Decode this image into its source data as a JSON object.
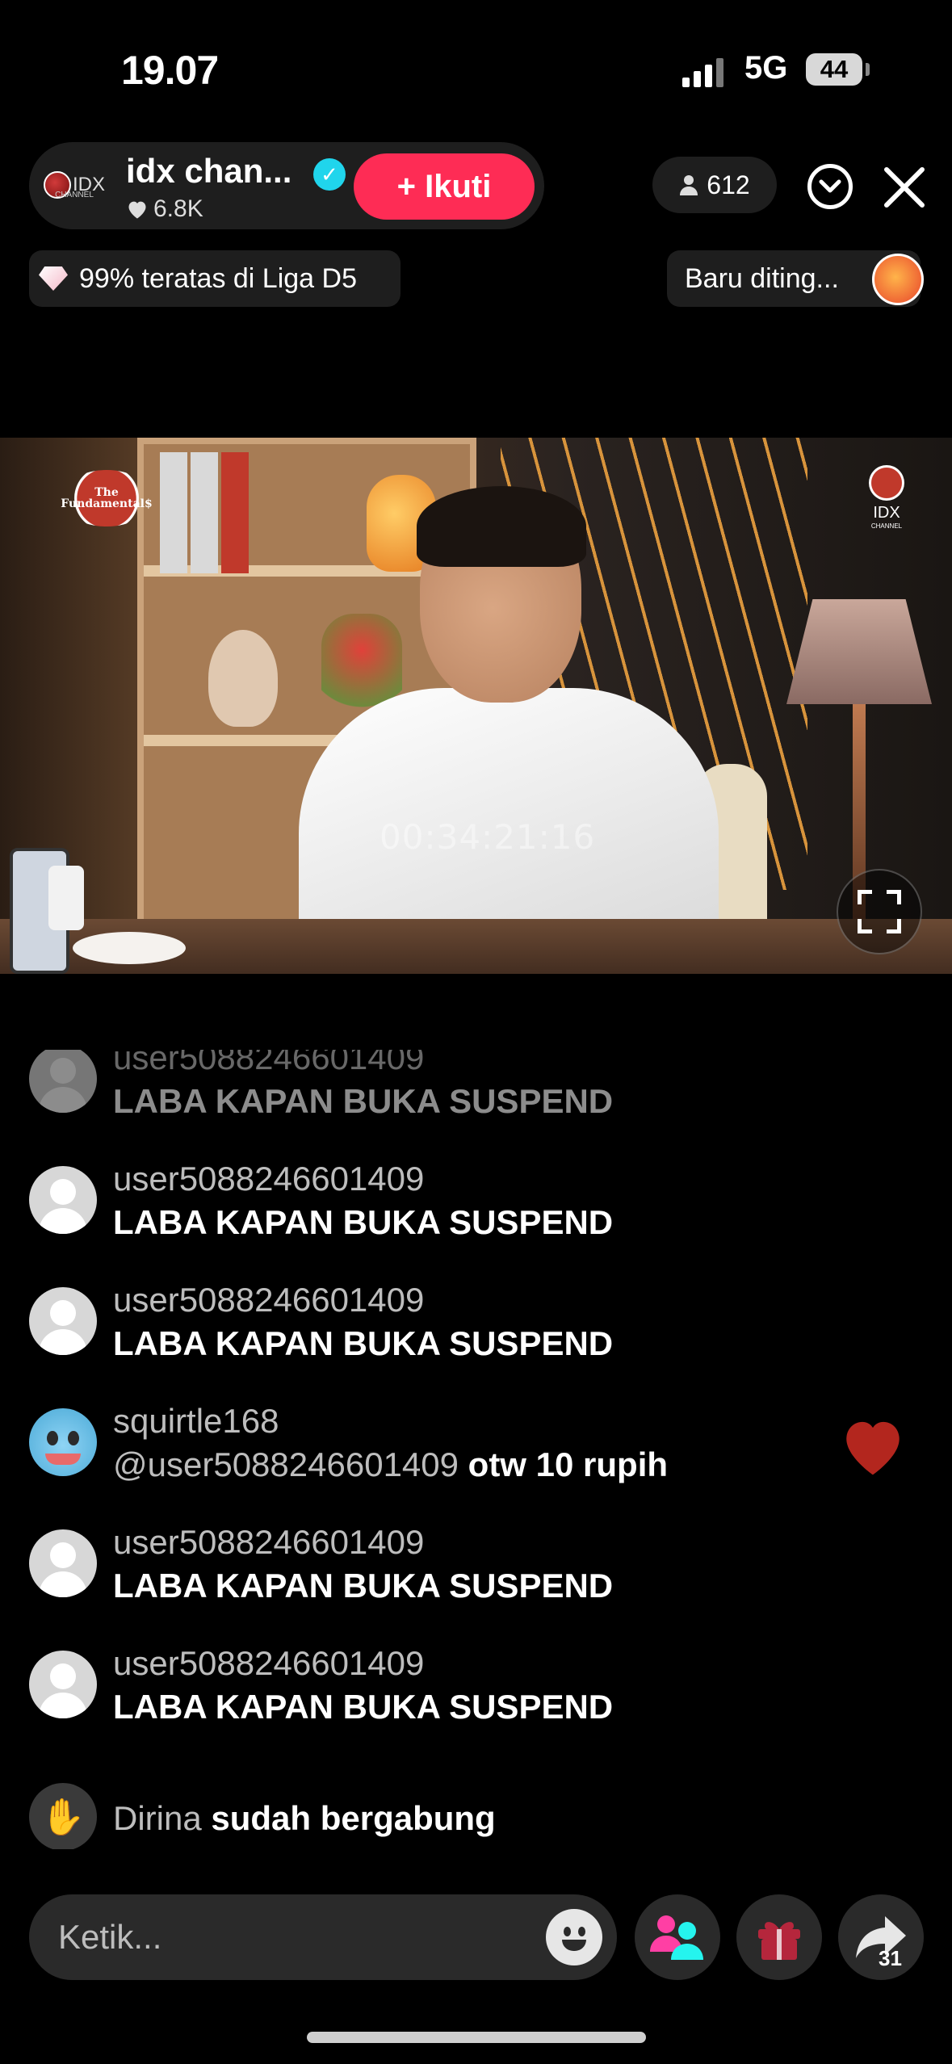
{
  "status_bar": {
    "time": "19.07",
    "network": "5G",
    "battery": "44"
  },
  "host": {
    "logo_text": "IDX",
    "logo_sub": "CHANNEL",
    "name": "idx chan...",
    "likes": "6.8K",
    "follow_label": "+ Ikuti"
  },
  "top_right": {
    "viewers": "612"
  },
  "badges": {
    "league": "99% teratas di Liga D5",
    "recent": "Baru diting..."
  },
  "video": {
    "show_logo": "The Fundamental$",
    "watermark": "IDX",
    "watermark_sub": "CHANNEL",
    "timecode": "00:34:21:16"
  },
  "comments": [
    {
      "user": "user5088246601409",
      "message": "LABA KAPAN BUKA SUSPEND",
      "avatar": "default"
    },
    {
      "user": "user5088246601409",
      "message": "LABA KAPAN BUKA SUSPEND",
      "avatar": "default"
    },
    {
      "user": "user5088246601409",
      "message": "LABA KAPAN BUKA SUSPEND",
      "avatar": "default"
    },
    {
      "user": "squirtle168",
      "mention": "@user5088246601409",
      "message": " otw 10 rupih",
      "avatar": "squirtle"
    },
    {
      "user": "user5088246601409",
      "message": "LABA KAPAN BUKA SUSPEND",
      "avatar": "default"
    },
    {
      "user": "user5088246601409",
      "message": "LABA KAPAN BUKA SUSPEND",
      "avatar": "default"
    }
  ],
  "join_event": {
    "user": "Dirina",
    "text": " sudah bergabung"
  },
  "bottom": {
    "input_placeholder": "Ketik...",
    "share_count": "31"
  },
  "colors": {
    "accent": "#fe2c55",
    "verify": "#20d5ec",
    "heart": "#b3261e",
    "gift": "#b5263c",
    "multiguest": "#ff3fa4"
  }
}
